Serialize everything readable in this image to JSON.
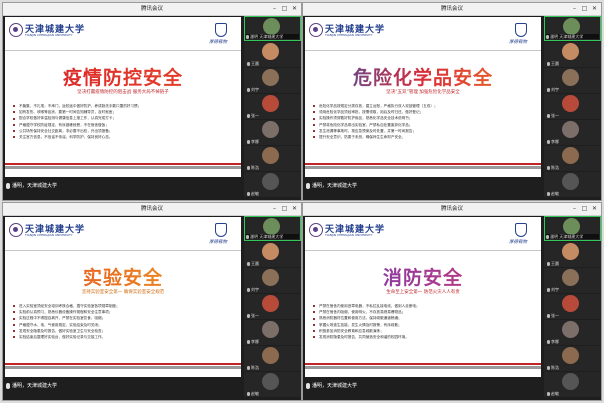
{
  "windows": [
    {
      "title": "腾讯会议",
      "slide": {
        "university": "天津城建大学",
        "university_en": "TIANJIN CHENGJIAN UNIVERSITY",
        "slogan": "厚德载物",
        "title": "疫情防控安全",
        "subtitle": "坚决打赢疫情防控的阻击战 服务大局不掉链子",
        "bullets": [
          "不聚集，不扎堆，不串门，返校途中做好防护，养成勤洗手戴口罩的好习惯；",
          "如有发热、咳嗽等症状，要第一时间告知辅导员，及时就医；",
          "配合学校做好体温检测与健康信息上报工作，认真完成打卡；",
          "严格遵守学校防疫规定，有序错峰就餐，不在宿舍做饭；",
          "公共场所保持安全社交距离，非必要不出校，外出须报备；",
          "关注官方信息，不信谣不传谣，科学防护，保持良好心态。"
        ]
      },
      "caption": "潘明，天津城建大学",
      "participants": [
        "潘明 天津城建大学",
        "王晨",
        "刘宇",
        "张一",
        "李娜",
        "陈浩",
        "赵敏"
      ]
    },
    {
      "title": "腾讯会议",
      "slide": {
        "university": "天津城建大学",
        "university_en": "TIANJIN CHENGJIAN UNIVERSITY",
        "slogan": "厚德载物",
        "title": "危险化学品安全",
        "subtitle": "坚决“五双”管理 加强危险化学品安全",
        "bullets": [
          "危险化学品按规定分类存放，建立台账，严格执行双人双锁管理（五双）；",
          "领用危险化学品须经审批，按需领取，用后及时归还，做好登记；",
          "实验操作须穿戴好防护用品，熟悉化学品安全技术说明书；",
          "严禁将危险化学品带出实验室，严禁私自处置废弃化学品；",
          "发生泄漏等事故时，按应急预案及时处置，并第一时间报告；",
          "提升安全意识，防患于未然，确保师生生命财产安全。"
        ]
      },
      "caption": "潘明，天津城建大学",
      "participants": [
        "潘明 天津城建大学",
        "王晨",
        "刘宇",
        "张一",
        "李娜",
        "陈浩",
        "赵敏"
      ]
    },
    {
      "title": "腾讯会议",
      "slide": {
        "university": "天津城建大学",
        "university_en": "TIANJIN CHENGJIAN UNIVERSITY",
        "slogan": "厚德载物",
        "title": "实验安全",
        "subtitle": "坚持实验室安全第一 确保实验室安全规范",
        "bullets": [
          "进入实验室须经安全培训考核合格，遵守实验室各项规章制度；",
          "实验前认真预习，熟悉仪器设备操作规程和安全注意事项；",
          "实验过程中不得擅自离开，严禁在实验室饮食、吸烟；",
          "严格遵守水、电、气使用规定，实验结束及时关闭；",
          "发现安全隐患及时报告，做好实验室卫生与安全检查；",
          "实验结束后整理好实验台，做好实验记录与交接工作。"
        ]
      },
      "caption": "潘明，天津城建大学",
      "participants": [
        "潘明 天津城建大学",
        "王晨",
        "刘宇",
        "张一",
        "李娜",
        "陈浩",
        "赵敏"
      ]
    },
    {
      "title": "腾讯会议",
      "slide": {
        "university": "天津城建大学",
        "university_en": "TIANJIN CHENGJIAN UNIVERSITY",
        "slogan": "厚德载物",
        "title": "消防安全",
        "subtitle": "生命至上安全第一 防范火灾人人有责",
        "bullets": [
          "严禁在宿舍内使用违章电器，不私拉乱接电线，做到人走断电；",
          "严禁在宿舍内吸烟、使用明火，不存放易燃易爆物品；",
          "熟悉消防器材位置和使用方法，保持疏散通道畅通；",
          "掌握火场逃生技能，发生火情及时报警，有序疏散；",
          "积极参加消防安全教育和应急疏散演练；",
          "发现消防隐患及时报告，共同营造安全和谐的校园环境。"
        ]
      },
      "caption": "潘明，天津城建大学",
      "participants": [
        "潘明 天津城建大学",
        "王晨",
        "刘宇",
        "张一",
        "李娜",
        "陈浩",
        "赵敏"
      ]
    }
  ],
  "colors": {
    "title_gradients": [
      "linear-gradient(90deg,#d9232a,#e8452a)",
      "linear-gradient(90deg,#2f55b4,#d92c3a,#ef7b1f)",
      "linear-gradient(90deg,#e34a1f,#f0a020)",
      "linear-gradient(90deg,#6a3bb7,#d83a6e)"
    ],
    "subtitle_colors": [
      "#c0262a",
      "#c0262a",
      "#d26a10",
      "#c0262a"
    ],
    "avatar_colors": [
      "#6b8e5a",
      "#c58b63",
      "#8a6f59",
      "#b84a3a",
      "#7c6f6a",
      "#8b6a4f",
      "#555555"
    ]
  }
}
